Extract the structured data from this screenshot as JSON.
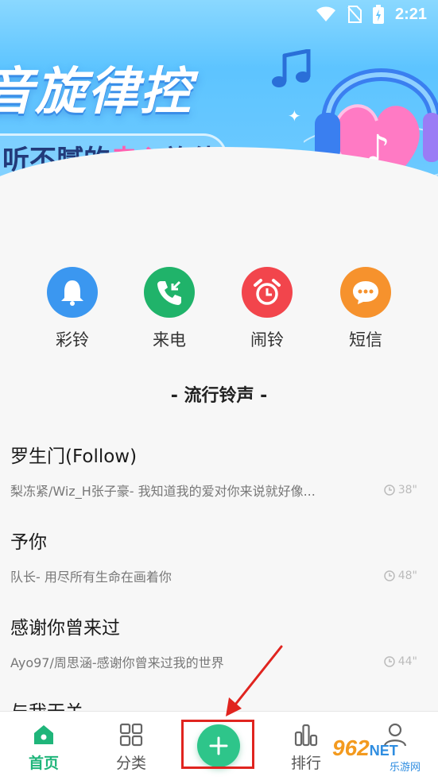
{
  "status_bar": {
    "time": "2:21"
  },
  "banner": {
    "title": "音旋律控",
    "subtitle_prefix": "听不腻的",
    "subtitle_highlight": "走心",
    "subtitle_suffix": "旋律"
  },
  "quick_links": [
    {
      "label": "彩铃",
      "icon": "bell-icon",
      "color": "#3b97f0"
    },
    {
      "label": "来电",
      "icon": "phone-icon",
      "color": "#20b36a"
    },
    {
      "label": "闹铃",
      "icon": "alarm-clock-icon",
      "color": "#f2454c"
    },
    {
      "label": "短信",
      "icon": "message-icon",
      "color": "#f6922d"
    }
  ],
  "section": {
    "title": "- 流行铃声 -"
  },
  "songs": [
    {
      "title": "罗生门(Follow)",
      "desc": "梨冻紧/Wiz_H张子豪- 我知道我的爱对你来说就好像...",
      "duration": "38\""
    },
    {
      "title": "予你",
      "desc": "队长- 用尽所有生命在画着你",
      "duration": "48\""
    },
    {
      "title": "感谢你曾来过",
      "desc": "Ayo97/周思涵-感谢你曾来过我的世界",
      "duration": "44\""
    },
    {
      "title": "与我无关",
      "desc": "",
      "duration": ""
    }
  ],
  "bottom_nav": {
    "home": "首页",
    "category": "分类",
    "ranking": "排行",
    "profile": ""
  },
  "watermark": {
    "main": "962",
    "net": "NET",
    "sub": "乐游网"
  },
  "colors": {
    "accent": "#2ec58a",
    "annotation": "#e0241f"
  }
}
